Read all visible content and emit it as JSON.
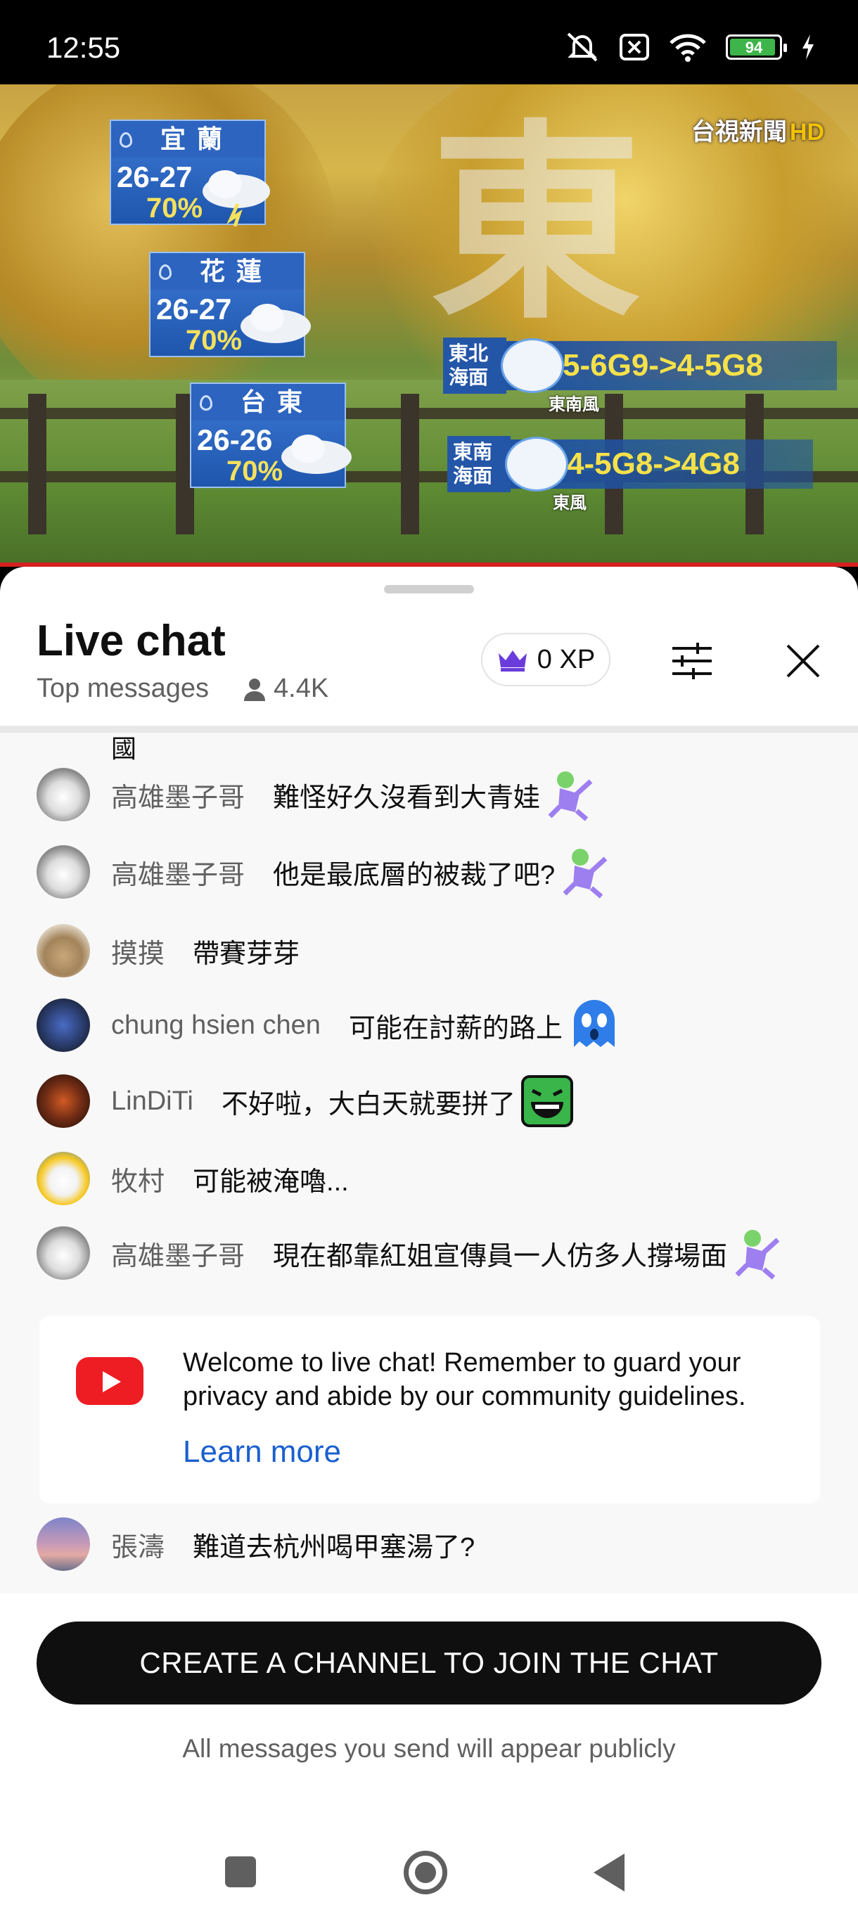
{
  "status_bar": {
    "time": "12:55",
    "battery": "94",
    "battery_fraction": 0.94,
    "icons": [
      "mute-icon",
      "no-sim-icon",
      "wifi-icon",
      "battery-icon",
      "charging-icon"
    ]
  },
  "video": {
    "brand": "台視新聞",
    "brand_hd": "HD",
    "big_char": "東",
    "cards": [
      {
        "city": "宜蘭",
        "temp": "26-27",
        "pct": "70%"
      },
      {
        "city": "花蓮",
        "temp": "26-27",
        "pct": "70%"
      },
      {
        "city": "台東",
        "temp": "26-26",
        "pct": "70%"
      }
    ],
    "winds": [
      {
        "area": "東北海面",
        "value": "5-6G9->4-5G8",
        "dir": "東南風"
      },
      {
        "area": "東南海面",
        "value": "4-5G8->4G8",
        "dir": "東風"
      }
    ]
  },
  "chat": {
    "title": "Live chat",
    "mode": "Top messages",
    "viewers": "4.4K",
    "xp": "0 XP",
    "cutoff_text": "國",
    "messages": [
      {
        "author": "高雄墨子哥",
        "text": "難怪好久沒看到大青娃",
        "emoji": "dancing-figure-emoji"
      },
      {
        "author": "高雄墨子哥",
        "text": "他是最底層的被裁了吧?",
        "emoji": "dancing-figure-emoji"
      },
      {
        "author": "摸摸",
        "text": "帶賽芽芽"
      },
      {
        "author": "chung hsien chen",
        "text": "可能在討薪的路上",
        "emoji": "blue-ghost-emoji"
      },
      {
        "author": "LinDiTi",
        "text": "不好啦，大白天就要拼了",
        "emoji": "green-laughing-emoji"
      },
      {
        "author": "牧村",
        "text": "可能被淹嚕..."
      },
      {
        "author": "高雄墨子哥",
        "text": "現在都靠紅姐宣傳員一人仿多人撐場面",
        "emoji": "dancing-figure-emoji"
      }
    ],
    "welcome": {
      "text": "Welcome to live chat! Remember to guard your privacy and abide by our community guidelines.",
      "link": "Learn more"
    },
    "last_message": {
      "author": "張濤",
      "text": "難道去杭州喝甲塞湯了?"
    },
    "cta": "CREATE A CHANNEL TO JOIN THE CHAT",
    "note": "All messages you send will appear publicly"
  },
  "colors": {
    "accent_link": "#1a5fd0",
    "youtube_red": "#ee1d23",
    "xp_crown": "#6a3cdb",
    "cta_bg": "#0f0f0f",
    "video_red_line": "#d61f1f"
  }
}
